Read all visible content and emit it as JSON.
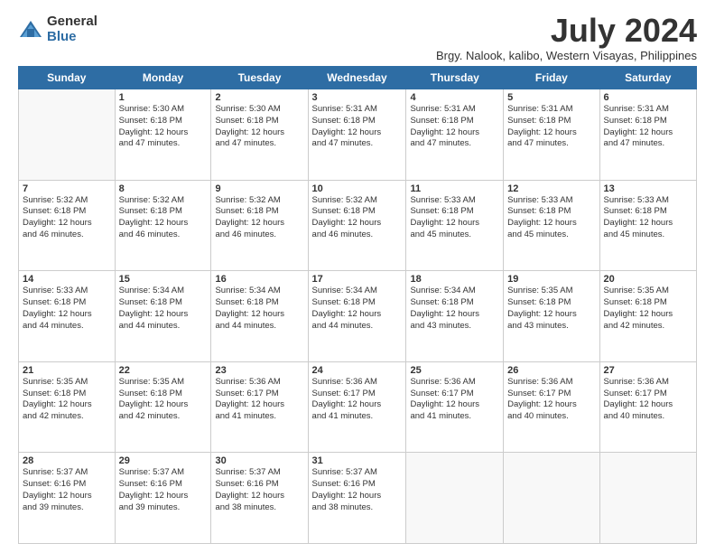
{
  "logo": {
    "general": "General",
    "blue": "Blue"
  },
  "title": "July 2024",
  "subtitle": "Brgy. Nalook, kalibo, Western Visayas, Philippines",
  "days": [
    "Sunday",
    "Monday",
    "Tuesday",
    "Wednesday",
    "Thursday",
    "Friday",
    "Saturday"
  ],
  "weeks": [
    [
      {
        "num": "",
        "info": ""
      },
      {
        "num": "1",
        "info": "Sunrise: 5:30 AM\nSunset: 6:18 PM\nDaylight: 12 hours\nand 47 minutes."
      },
      {
        "num": "2",
        "info": "Sunrise: 5:30 AM\nSunset: 6:18 PM\nDaylight: 12 hours\nand 47 minutes."
      },
      {
        "num": "3",
        "info": "Sunrise: 5:31 AM\nSunset: 6:18 PM\nDaylight: 12 hours\nand 47 minutes."
      },
      {
        "num": "4",
        "info": "Sunrise: 5:31 AM\nSunset: 6:18 PM\nDaylight: 12 hours\nand 47 minutes."
      },
      {
        "num": "5",
        "info": "Sunrise: 5:31 AM\nSunset: 6:18 PM\nDaylight: 12 hours\nand 47 minutes."
      },
      {
        "num": "6",
        "info": "Sunrise: 5:31 AM\nSunset: 6:18 PM\nDaylight: 12 hours\nand 47 minutes."
      }
    ],
    [
      {
        "num": "7",
        "info": "Sunrise: 5:32 AM\nSunset: 6:18 PM\nDaylight: 12 hours\nand 46 minutes."
      },
      {
        "num": "8",
        "info": "Sunrise: 5:32 AM\nSunset: 6:18 PM\nDaylight: 12 hours\nand 46 minutes."
      },
      {
        "num": "9",
        "info": "Sunrise: 5:32 AM\nSunset: 6:18 PM\nDaylight: 12 hours\nand 46 minutes."
      },
      {
        "num": "10",
        "info": "Sunrise: 5:32 AM\nSunset: 6:18 PM\nDaylight: 12 hours\nand 46 minutes."
      },
      {
        "num": "11",
        "info": "Sunrise: 5:33 AM\nSunset: 6:18 PM\nDaylight: 12 hours\nand 45 minutes."
      },
      {
        "num": "12",
        "info": "Sunrise: 5:33 AM\nSunset: 6:18 PM\nDaylight: 12 hours\nand 45 minutes."
      },
      {
        "num": "13",
        "info": "Sunrise: 5:33 AM\nSunset: 6:18 PM\nDaylight: 12 hours\nand 45 minutes."
      }
    ],
    [
      {
        "num": "14",
        "info": "Sunrise: 5:33 AM\nSunset: 6:18 PM\nDaylight: 12 hours\nand 44 minutes."
      },
      {
        "num": "15",
        "info": "Sunrise: 5:34 AM\nSunset: 6:18 PM\nDaylight: 12 hours\nand 44 minutes."
      },
      {
        "num": "16",
        "info": "Sunrise: 5:34 AM\nSunset: 6:18 PM\nDaylight: 12 hours\nand 44 minutes."
      },
      {
        "num": "17",
        "info": "Sunrise: 5:34 AM\nSunset: 6:18 PM\nDaylight: 12 hours\nand 44 minutes."
      },
      {
        "num": "18",
        "info": "Sunrise: 5:34 AM\nSunset: 6:18 PM\nDaylight: 12 hours\nand 43 minutes."
      },
      {
        "num": "19",
        "info": "Sunrise: 5:35 AM\nSunset: 6:18 PM\nDaylight: 12 hours\nand 43 minutes."
      },
      {
        "num": "20",
        "info": "Sunrise: 5:35 AM\nSunset: 6:18 PM\nDaylight: 12 hours\nand 42 minutes."
      }
    ],
    [
      {
        "num": "21",
        "info": "Sunrise: 5:35 AM\nSunset: 6:18 PM\nDaylight: 12 hours\nand 42 minutes."
      },
      {
        "num": "22",
        "info": "Sunrise: 5:35 AM\nSunset: 6:18 PM\nDaylight: 12 hours\nand 42 minutes."
      },
      {
        "num": "23",
        "info": "Sunrise: 5:36 AM\nSunset: 6:17 PM\nDaylight: 12 hours\nand 41 minutes."
      },
      {
        "num": "24",
        "info": "Sunrise: 5:36 AM\nSunset: 6:17 PM\nDaylight: 12 hours\nand 41 minutes."
      },
      {
        "num": "25",
        "info": "Sunrise: 5:36 AM\nSunset: 6:17 PM\nDaylight: 12 hours\nand 41 minutes."
      },
      {
        "num": "26",
        "info": "Sunrise: 5:36 AM\nSunset: 6:17 PM\nDaylight: 12 hours\nand 40 minutes."
      },
      {
        "num": "27",
        "info": "Sunrise: 5:36 AM\nSunset: 6:17 PM\nDaylight: 12 hours\nand 40 minutes."
      }
    ],
    [
      {
        "num": "28",
        "info": "Sunrise: 5:37 AM\nSunset: 6:16 PM\nDaylight: 12 hours\nand 39 minutes."
      },
      {
        "num": "29",
        "info": "Sunrise: 5:37 AM\nSunset: 6:16 PM\nDaylight: 12 hours\nand 39 minutes."
      },
      {
        "num": "30",
        "info": "Sunrise: 5:37 AM\nSunset: 6:16 PM\nDaylight: 12 hours\nand 38 minutes."
      },
      {
        "num": "31",
        "info": "Sunrise: 5:37 AM\nSunset: 6:16 PM\nDaylight: 12 hours\nand 38 minutes."
      },
      {
        "num": "",
        "info": ""
      },
      {
        "num": "",
        "info": ""
      },
      {
        "num": "",
        "info": ""
      }
    ]
  ]
}
